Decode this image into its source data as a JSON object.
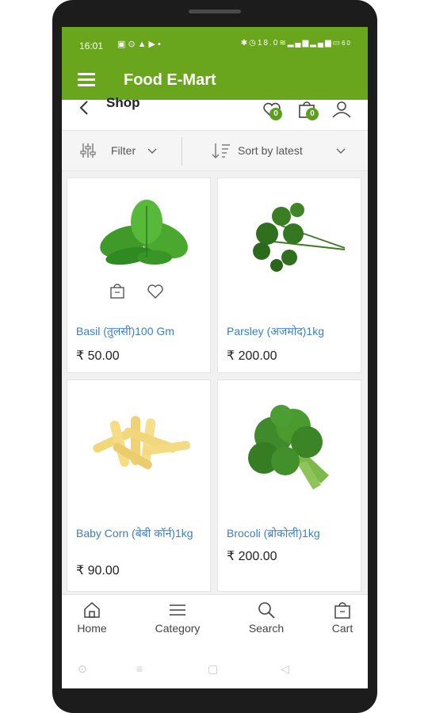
{
  "status": {
    "time": "16:01",
    "left_icons": [
      "notification-icon",
      "location-icon",
      "navigation-icon",
      "youtube-icon",
      "dot-icon"
    ],
    "right_icons": [
      "bluetooth-icon",
      "alarm-icon",
      "data-speed-icon",
      "wifi-icon",
      "volte-icon",
      "signal-icon",
      "signal-icon",
      "battery-icon"
    ],
    "speed_label": "18.0",
    "battery_label": "60"
  },
  "appbar": {
    "title": "Food E-Mart",
    "color": "#6aa51e"
  },
  "page": {
    "title": "Shop",
    "wishlist_count": "0",
    "cart_count": "0"
  },
  "filterbar": {
    "filter_label": "Filter",
    "sort_label": "Sort by latest"
  },
  "products": [
    {
      "name": "Basil (तुलसी)100 Gm",
      "price": "₹ 50.00",
      "image": "basil-leaves"
    },
    {
      "name": "Parsley (अजमोद)1kg",
      "price": "₹ 200.00",
      "image": "parsley-bunch"
    },
    {
      "name": "Baby Corn (बेबी कॉर्न)1kg",
      "price": "₹ 90.00",
      "image": "baby-corn"
    },
    {
      "name": "Brocoli (ब्रोकोली)1kg",
      "price": "₹ 200.00",
      "image": "broccoli"
    }
  ],
  "bottom_nav": [
    {
      "label": "Home",
      "icon": "home-icon"
    },
    {
      "label": "Category",
      "icon": "menu-icon"
    },
    {
      "label": "Search",
      "icon": "search-icon"
    },
    {
      "label": "Cart",
      "icon": "cart-icon"
    }
  ],
  "colors": {
    "brand_green": "#6aa51e",
    "badge_green": "#5c9e1e",
    "link_blue": "#3a7fc4"
  }
}
